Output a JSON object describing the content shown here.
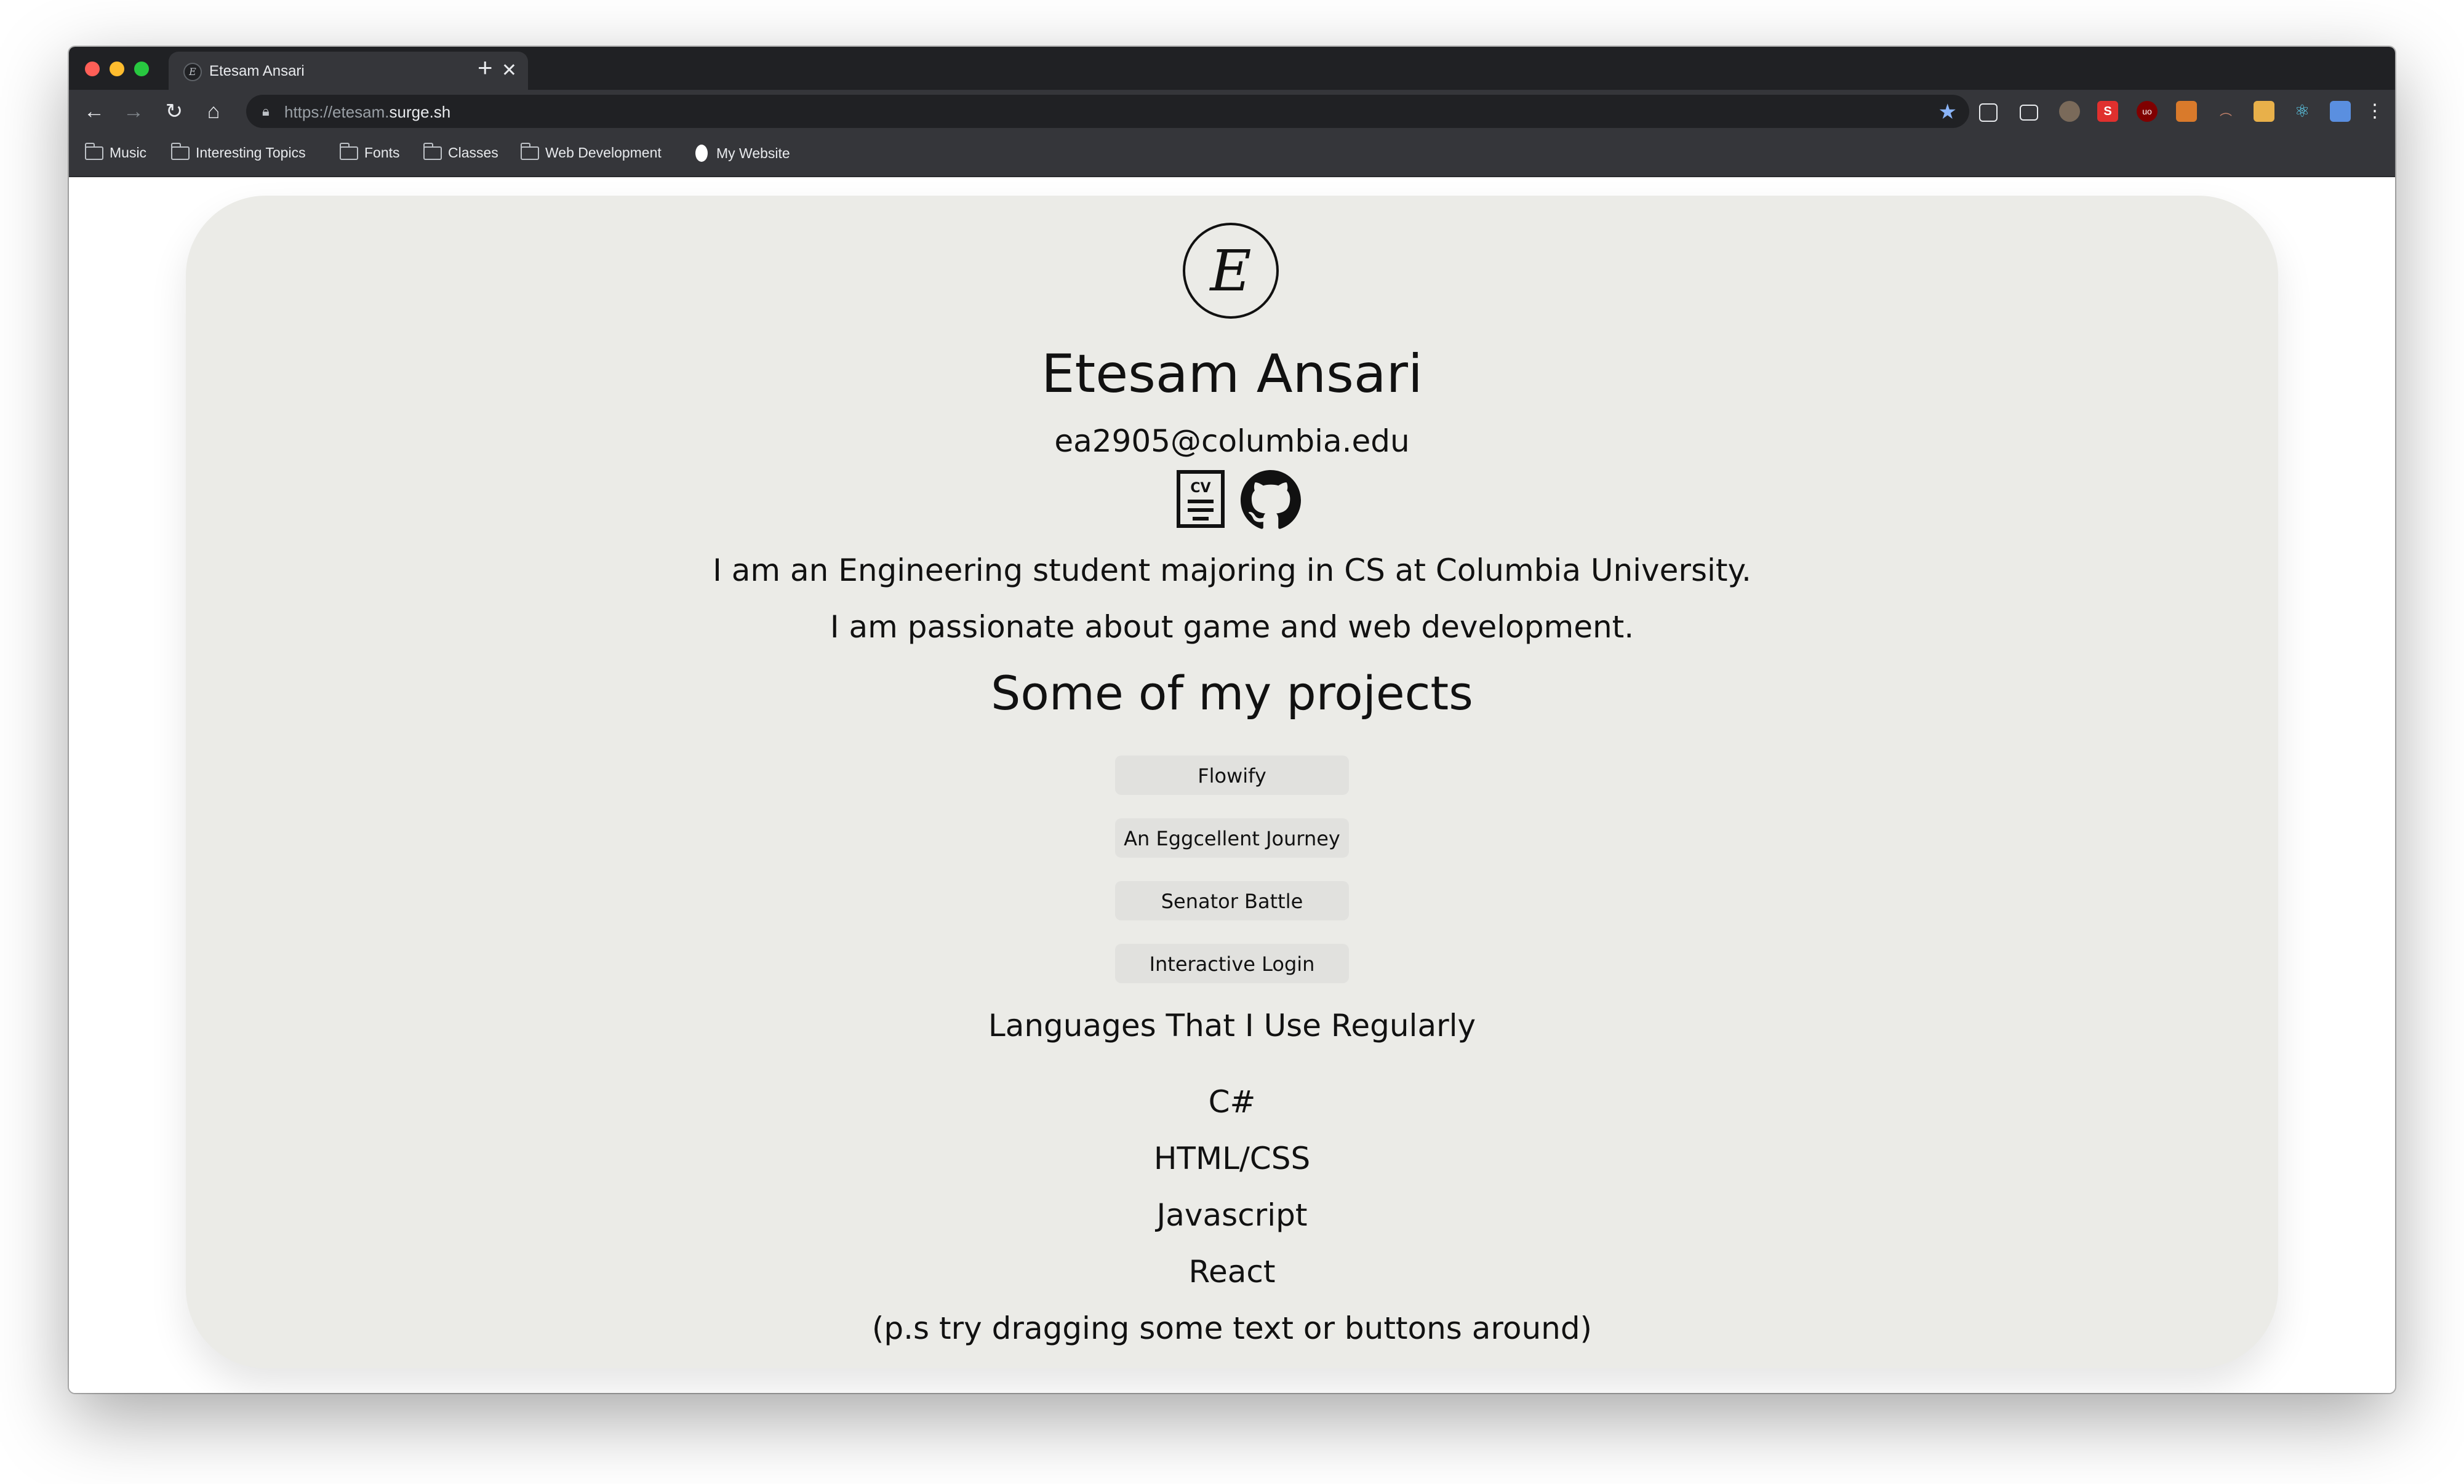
{
  "browser": {
    "tab_title": "Etesam Ansari",
    "url_scheme": "https://etesam.",
    "url_host": "surge.sh",
    "bookmarks": [
      {
        "label": "Music",
        "type": "folder"
      },
      {
        "label": "Interesting Topics",
        "type": "folder"
      },
      {
        "label": "Fonts",
        "type": "folder"
      },
      {
        "label": "Classes",
        "type": "folder"
      },
      {
        "label": "Web Development",
        "type": "folder"
      },
      {
        "label": "My Website",
        "type": "site"
      }
    ],
    "colors": {
      "tabstrip": "#202124",
      "toolbar": "#35363a",
      "star": "#8ab4f8"
    }
  },
  "profile": {
    "logo_letter": "E",
    "name": "Etesam Ansari",
    "email": "ea2905@columbia.edu",
    "links": [
      {
        "icon": "cv-icon",
        "text": "CV"
      },
      {
        "icon": "github-icon"
      }
    ],
    "bio": [
      "I am an Engineering student majoring in CS at Columbia University.",
      "I am passionate about game and web development."
    ]
  },
  "projects": {
    "heading": "Some of my projects",
    "items": [
      "Flowify",
      "An Eggcellent Journey",
      "Senator Battle",
      "Interactive Login"
    ]
  },
  "languages": {
    "heading": "Languages That I Use Regularly",
    "items": [
      "C#",
      "HTML/CSS",
      "Javascript",
      "React"
    ]
  },
  "footer_note": "(p.s try dragging some text or buttons around)",
  "colors": {
    "card": "#ebebe7",
    "button": "#e1e1de",
    "text": "#111111"
  }
}
